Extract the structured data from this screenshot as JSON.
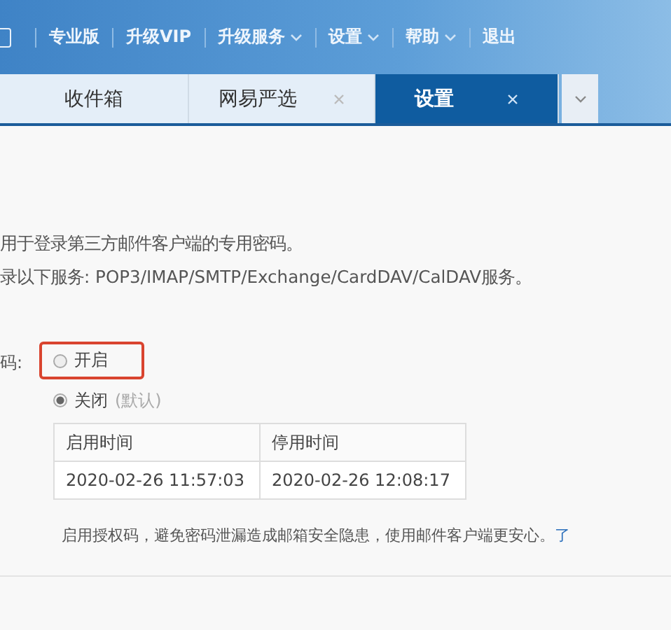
{
  "top_nav": [
    {
      "label": "专业版",
      "caret": false
    },
    {
      "label": "升级VIP",
      "caret": false
    },
    {
      "label": "升级服务",
      "caret": true
    },
    {
      "label": "设置",
      "caret": true
    },
    {
      "label": "帮助",
      "caret": true
    },
    {
      "label": "退出",
      "caret": false
    }
  ],
  "tabs": [
    {
      "label": "收件箱",
      "selected": false,
      "closable": false
    },
    {
      "label": "网易严选",
      "selected": false,
      "closable": true
    },
    {
      "label": "设置",
      "selected": true,
      "closable": true
    }
  ],
  "description": [
    "用于登录第三方邮件客户端的专用密码。",
    "录以下服务: POP3/IMAP/SMTP/Exchange/CardDAV/CalDAV服务。"
  ],
  "setting": {
    "label": "码:",
    "options": [
      {
        "label": "开启",
        "selected": false,
        "highlighted": true
      },
      {
        "label": "关闭",
        "note": "(默认)",
        "selected": true,
        "highlighted": false
      }
    ]
  },
  "table": {
    "columns": [
      "启用时间",
      "停用时间"
    ],
    "rows": [
      [
        "2020-02-26 11:57:03",
        "2020-02-26 12:08:17"
      ]
    ]
  },
  "footer": {
    "text": "启用授权码，避免密码泄漏造成邮箱安全隐患，使用邮件客户端更安心。",
    "link": "了"
  }
}
